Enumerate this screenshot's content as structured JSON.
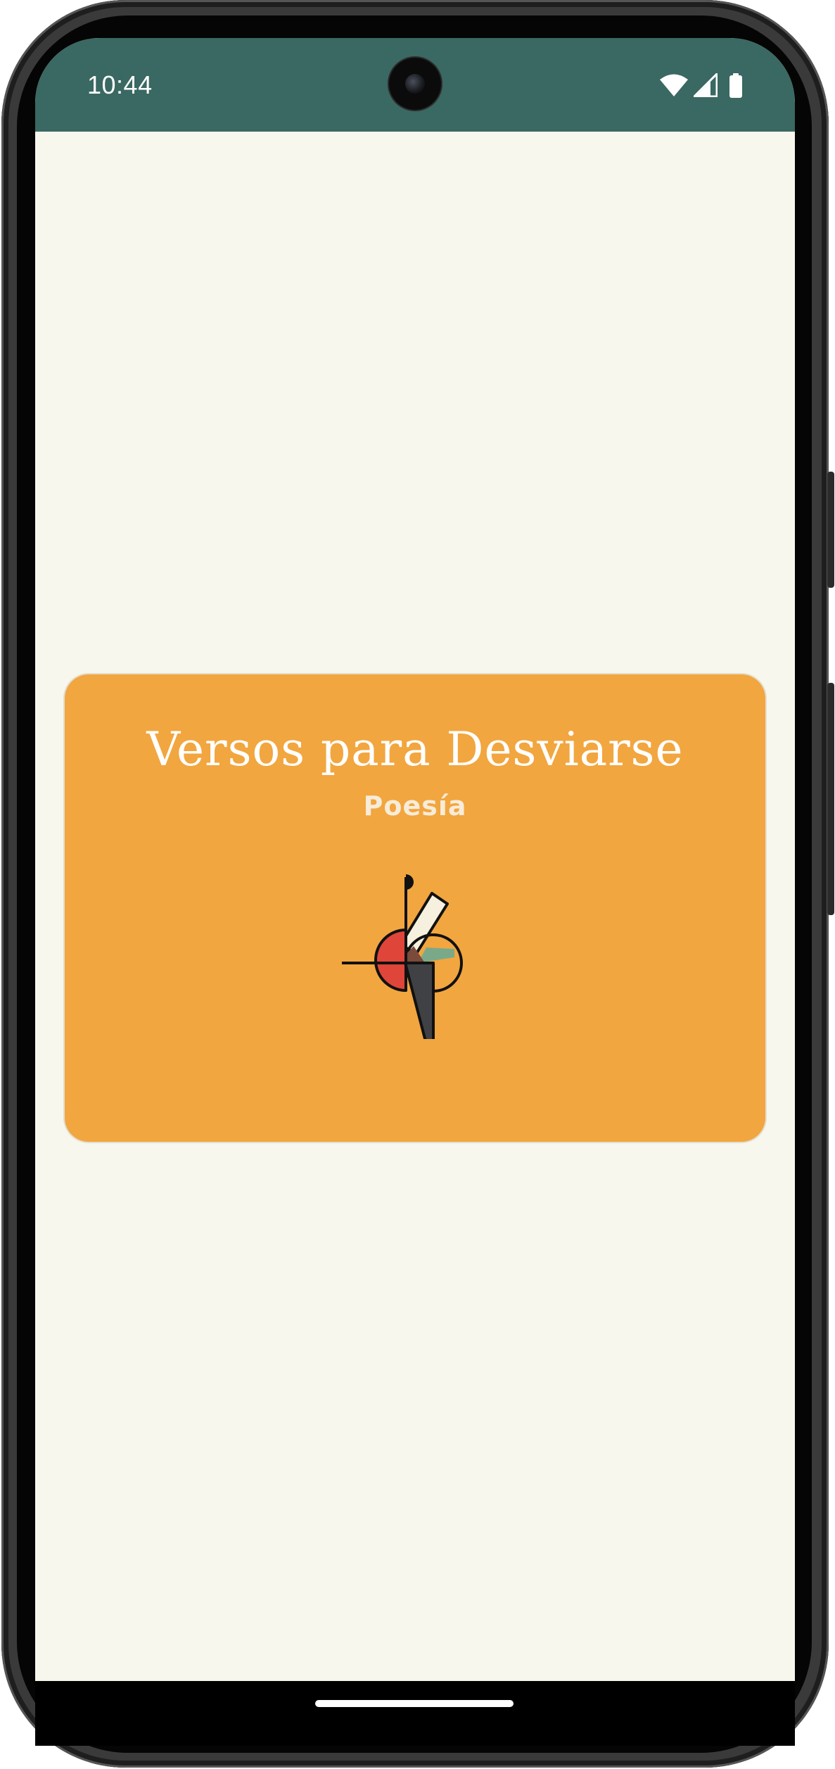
{
  "status_bar": {
    "time": "10:44",
    "icons": [
      "wifi-icon",
      "cellular-signal-icon",
      "battery-icon"
    ]
  },
  "card": {
    "title": "Versos para Desviarse",
    "subtitle": "Poesía",
    "logo": "abstract-geometric-logo"
  },
  "colors": {
    "status_bar": "#3a6862",
    "screen_background": "#f8f7ed",
    "card_background": "#f2a63f"
  }
}
